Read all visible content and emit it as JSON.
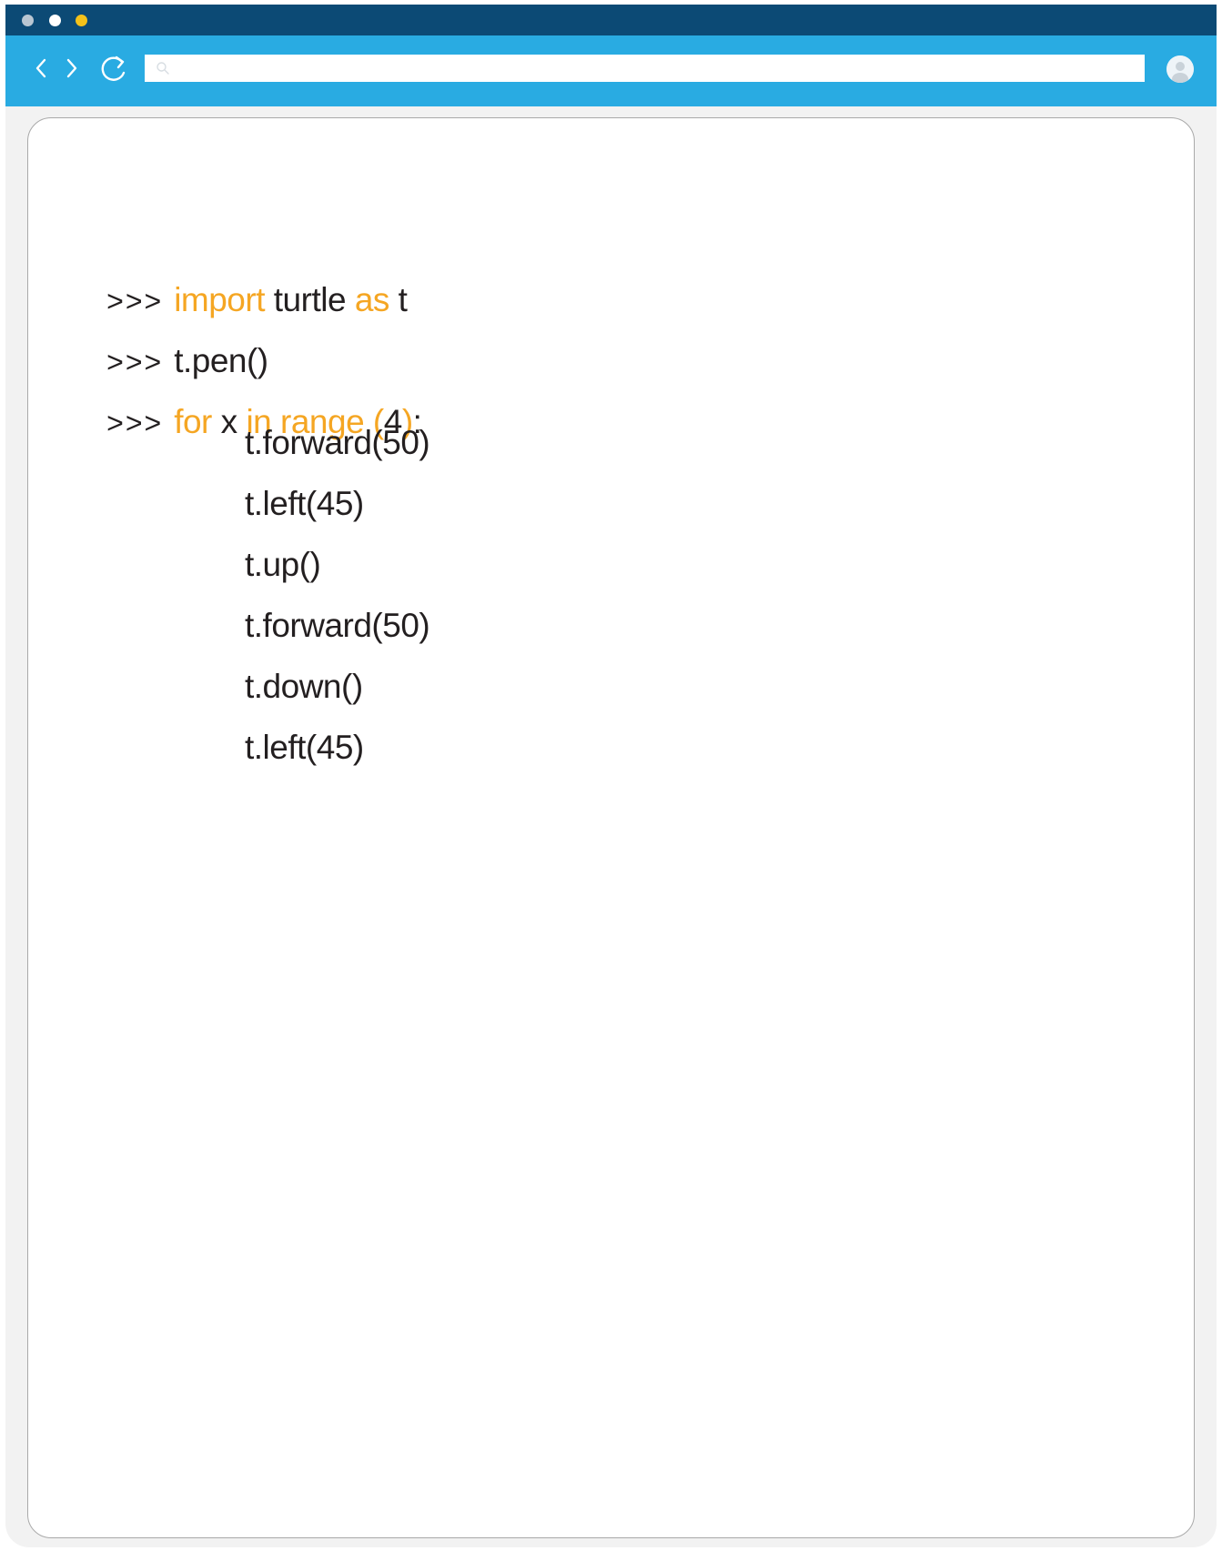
{
  "window": {
    "buttons": [
      "close",
      "minimize",
      "maximize"
    ],
    "colors": {
      "titlebar": "#0c4a75",
      "toolbar": "#29abe2",
      "close": "#b9c6d2",
      "minimize": "#ffffff",
      "maximize": "#f4c21a"
    }
  },
  "toolbar": {
    "back_icon": "chevron-left-icon",
    "forward_icon": "chevron-right-icon",
    "reload_icon": "reload-icon",
    "search_icon": "search-icon",
    "address_value": "",
    "avatar_icon": "user-avatar-icon"
  },
  "code": {
    "prompt": ">>>",
    "keyword_color": "#f5a623",
    "lines": [
      {
        "kw1": "import",
        "t1": " turtle ",
        "kw2": "as",
        "t2": " t"
      },
      {
        "t1": "t.pen()"
      },
      {
        "kw1": "for",
        "t1": " x ",
        "kw2": "in range",
        "kw3": " (",
        "t2": "4",
        "kw4": ")",
        "t3": ":"
      },
      {
        "t1": "t.forward(50)"
      },
      {
        "t1": "t.left(45)"
      },
      {
        "t1": "t.up()"
      },
      {
        "t1": "t.forward(50)"
      },
      {
        "t1": "t.down()"
      },
      {
        "t1": "t.left(45)"
      }
    ]
  }
}
